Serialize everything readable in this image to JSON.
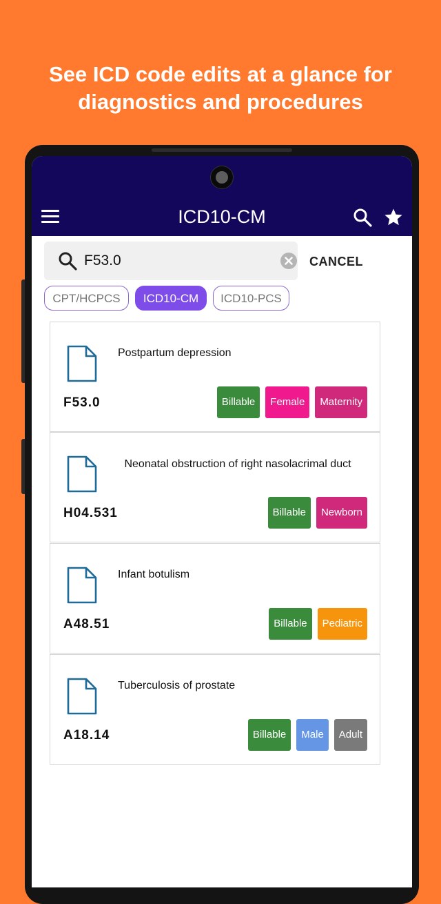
{
  "headline": {
    "line1": "See ICD code edits at a glance for",
    "line2": "diagnostics and procedures"
  },
  "appbar": {
    "title": "ICD10-CM"
  },
  "search": {
    "value": "F53.0",
    "cancel_label": "CANCEL"
  },
  "chips": [
    {
      "label": "CPT/HCPCS",
      "active": false
    },
    {
      "label": "ICD10-CM",
      "active": true
    },
    {
      "label": "ICD10-PCS",
      "active": false
    }
  ],
  "results": [
    {
      "title": "Postpartum depression",
      "code": "F53.0",
      "tags": [
        "Billable",
        "Female",
        "Maternity"
      ]
    },
    {
      "title": "Neonatal obstruction of right nasolacrimal duct",
      "code": "H04.531",
      "tags": [
        "Billable",
        "Newborn"
      ]
    },
    {
      "title": "Infant botulism",
      "code": "A48.51",
      "tags": [
        "Billable",
        "Pediatric"
      ]
    },
    {
      "title": "Tuberculosis of prostate",
      "code": "A18.14",
      "tags": [
        "Billable",
        "Male",
        "Adult"
      ]
    }
  ],
  "colors": {
    "background": "#FF7A2F",
    "appbar": "#12075A",
    "chip_active": "#7E4CE8",
    "billable": "#3A8B3C",
    "female": "#F1198E",
    "maternity": "#D0287A",
    "pediatric": "#F7940E",
    "male": "#6496E5",
    "adult": "#7A7A7A"
  },
  "icons": {
    "menu": "hamburger-menu-icon",
    "search": "search-icon",
    "favorite": "star-icon",
    "clear": "clear-icon",
    "result": "document-icon"
  }
}
